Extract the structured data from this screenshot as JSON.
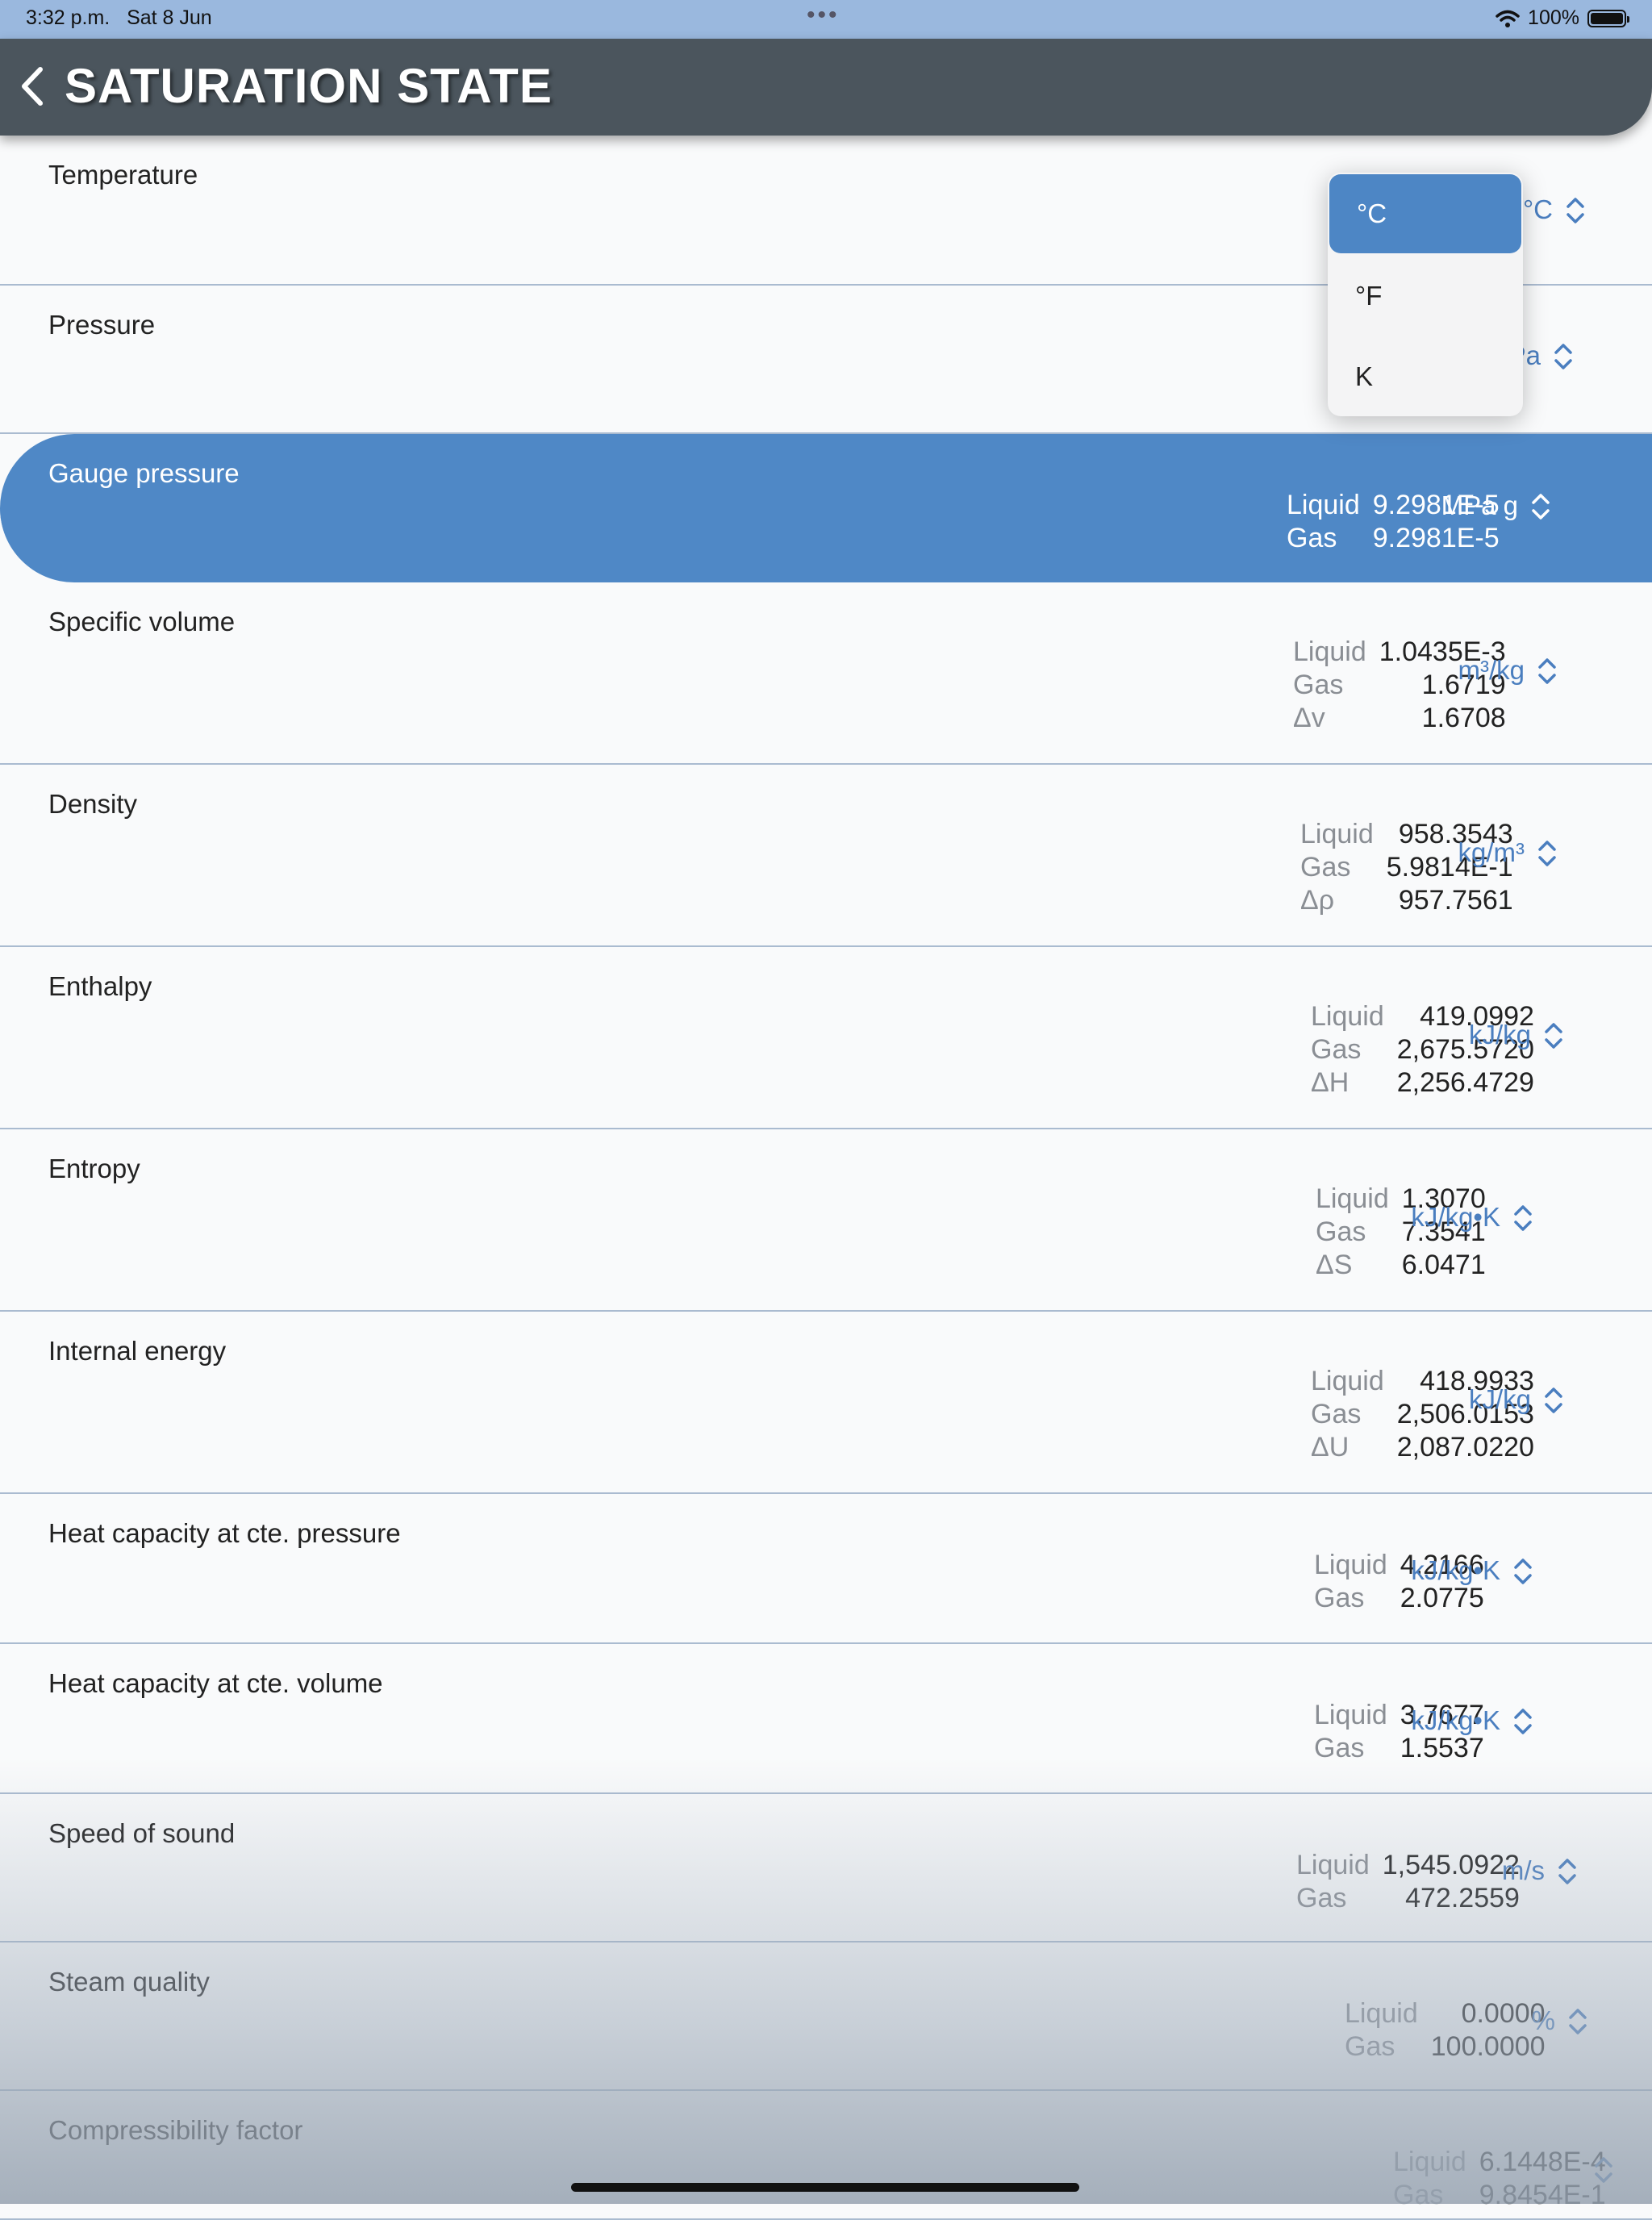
{
  "status_bar": {
    "time": "3:32 p.m.",
    "date": "Sat 8 Jun",
    "battery": "100%"
  },
  "header": {
    "title": "SATURATION STATE"
  },
  "dropdown": {
    "options": [
      "°C",
      "°F",
      "K"
    ],
    "selected": "°C"
  },
  "rows": [
    {
      "label": "Temperature",
      "values": [],
      "unit": "°C"
    },
    {
      "label": "Pressure",
      "values": [],
      "unit": "MPa"
    },
    {
      "label": "Gauge pressure",
      "values": [
        [
          "Liquid",
          "9.2981E-5"
        ],
        [
          "Gas",
          "9.2981E-5"
        ]
      ],
      "unit": "MPa g"
    },
    {
      "label": "Specific volume",
      "values": [
        [
          "Liquid",
          "1.0435E-3"
        ],
        [
          "Gas",
          "1.6719"
        ],
        [
          "Δv",
          "1.6708"
        ]
      ],
      "unit": "m³/kg"
    },
    {
      "label": "Density",
      "values": [
        [
          "Liquid",
          "958.3543"
        ],
        [
          "Gas",
          "5.9814E-1"
        ],
        [
          "Δρ",
          "957.7561"
        ]
      ],
      "unit": "kg/m³"
    },
    {
      "label": "Enthalpy",
      "values": [
        [
          "Liquid",
          "419.0992"
        ],
        [
          "Gas",
          "2,675.5720"
        ],
        [
          "ΔH",
          "2,256.4729"
        ]
      ],
      "unit": "kJ/kg"
    },
    {
      "label": "Entropy",
      "values": [
        [
          "Liquid",
          "1.3070"
        ],
        [
          "Gas",
          "7.3541"
        ],
        [
          "ΔS",
          "6.0471"
        ]
      ],
      "unit": "kJ/kg•K"
    },
    {
      "label": "Internal energy",
      "values": [
        [
          "Liquid",
          "418.9933"
        ],
        [
          "Gas",
          "2,506.0153"
        ],
        [
          "ΔU",
          "2,087.0220"
        ]
      ],
      "unit": "kJ/kg"
    },
    {
      "label": "Heat capacity at cte. pressure",
      "values": [
        [
          "Liquid",
          "4.2166"
        ],
        [
          "Gas",
          "2.0775"
        ]
      ],
      "unit": "kJ/kg•K"
    },
    {
      "label": "Heat capacity at cte. volume",
      "values": [
        [
          "Liquid",
          "3.7677"
        ],
        [
          "Gas",
          "1.5537"
        ]
      ],
      "unit": "kJ/kg•K"
    },
    {
      "label": "Speed of sound",
      "values": [
        [
          "Liquid",
          "1,545.0922"
        ],
        [
          "Gas",
          "472.2559"
        ]
      ],
      "unit": "m/s"
    },
    {
      "label": "Steam quality",
      "values": [
        [
          "Liquid",
          "0.0000"
        ],
        [
          "Gas",
          "100.0000"
        ]
      ],
      "unit": "%"
    },
    {
      "label": "Compressibility factor",
      "values": [
        [
          "Liquid",
          "6.1448E-4"
        ],
        [
          "Gas",
          "9.8454E-1"
        ]
      ],
      "unit": ""
    }
  ]
}
